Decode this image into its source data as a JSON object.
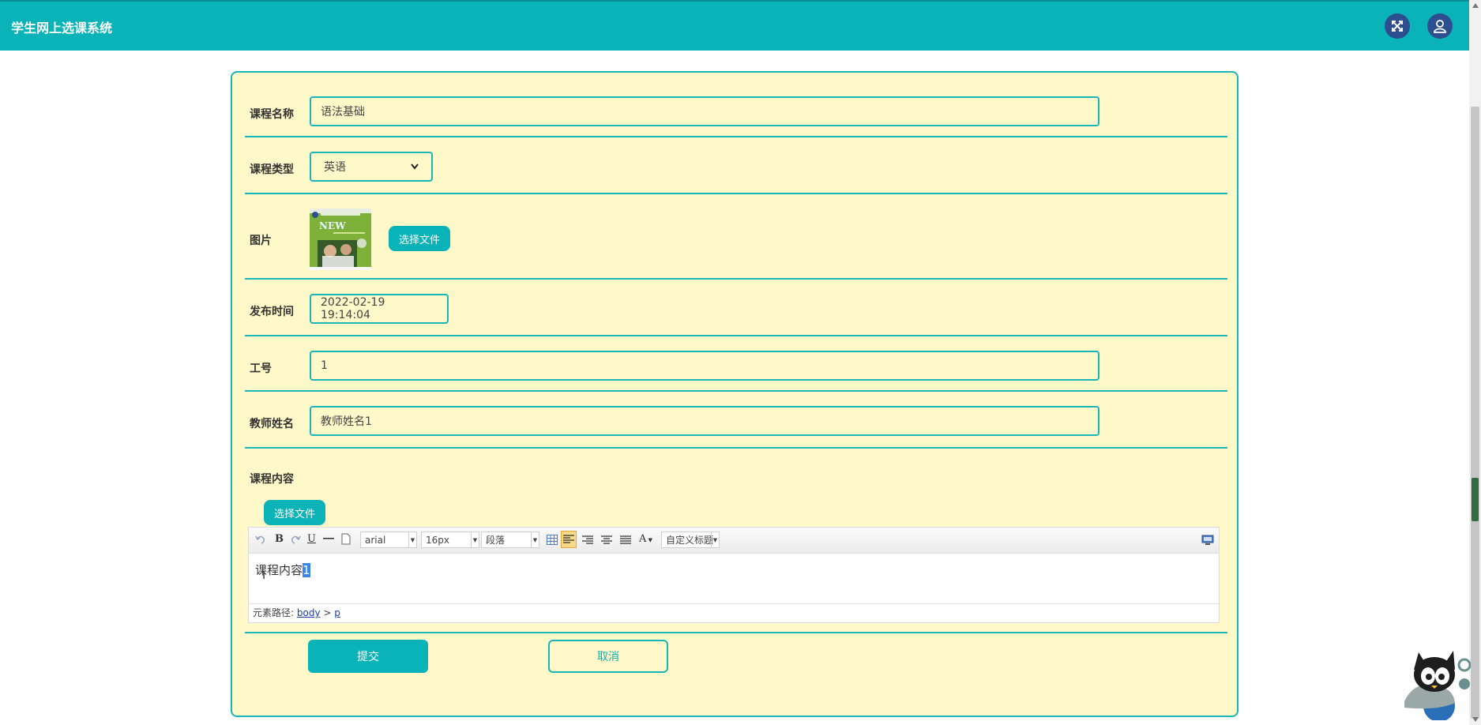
{
  "header": {
    "app_title": "学生网上选课系统",
    "icons": [
      "fullscreen-icon",
      "user-icon"
    ]
  },
  "form": {
    "course_name": {
      "label": "课程名称",
      "value": "语法基础"
    },
    "course_type": {
      "label": "课程类型",
      "value": "英语"
    },
    "image": {
      "label": "图片",
      "upload_label": "选择文件"
    },
    "publish_time": {
      "label": "发布时间",
      "value": "2022-02-19 19:14:04"
    },
    "employee_id": {
      "label": "工号",
      "value": "1"
    },
    "teacher_name": {
      "label": "教师姓名",
      "value": "教师姓名1"
    },
    "course_content": {
      "label": "课程内容",
      "upload_label": "选择文件",
      "text_before": "课程内容",
      "text_selected": "1"
    }
  },
  "editor": {
    "font_family": "arial",
    "font_size": "16px",
    "paragraph": "段落",
    "custom_title": "自定义标题",
    "font_color_label": "A",
    "path_label": "元素路径:",
    "path_body": "body",
    "path_sep": ">",
    "path_p": "p",
    "bold_label": "B",
    "underline_label": "U"
  },
  "actions": {
    "submit": "提交",
    "cancel": "取消"
  },
  "colors": {
    "accent": "#0ab3b8",
    "form_bg": "#fff8c8",
    "icon_button": "#2d4e8f"
  }
}
